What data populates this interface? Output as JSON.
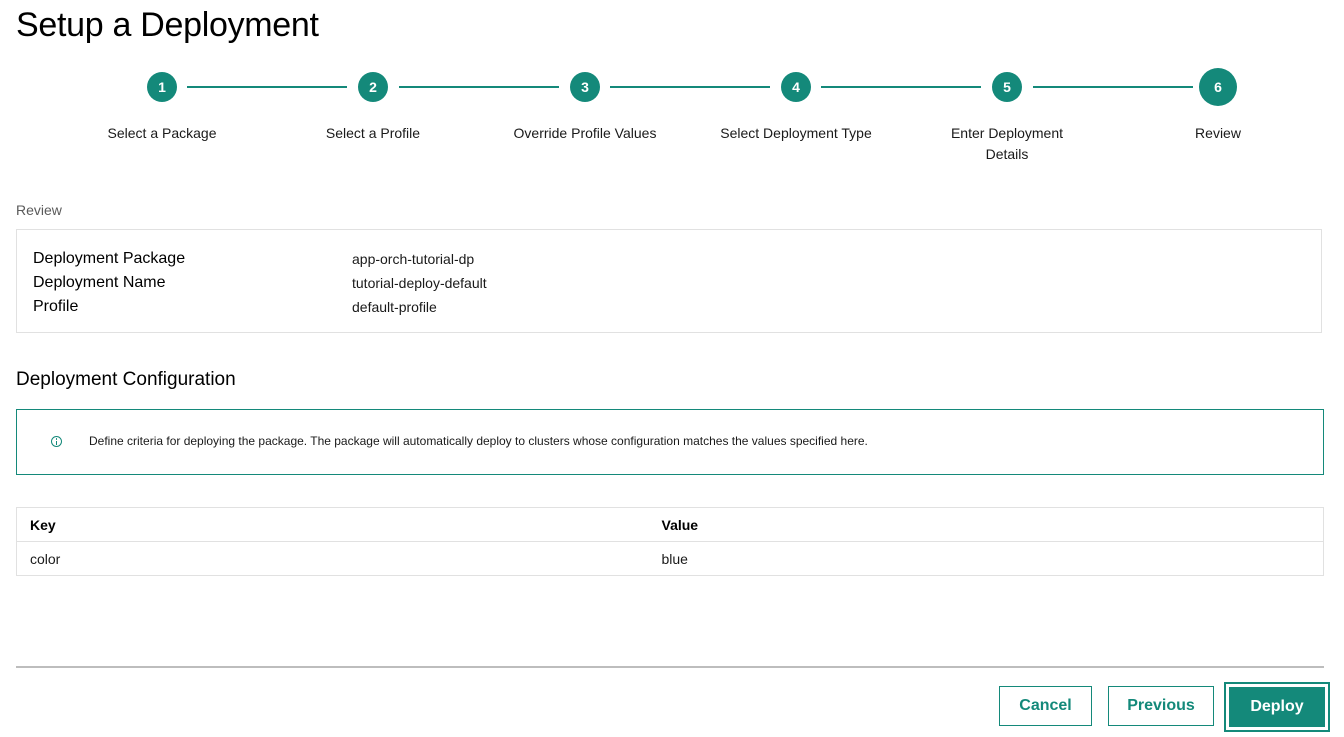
{
  "page_title": "Setup a Deployment",
  "stepper": {
    "steps": [
      {
        "number": "1",
        "label": "Select a Package"
      },
      {
        "number": "2",
        "label": "Select a Profile"
      },
      {
        "number": "3",
        "label": "Override Profile Values"
      },
      {
        "number": "4",
        "label": "Select Deployment Type"
      },
      {
        "number": "5",
        "label": "Enter Deployment Details"
      },
      {
        "number": "6",
        "label": "Review"
      }
    ],
    "current_step": "6"
  },
  "review": {
    "section_label": "Review",
    "rows": [
      {
        "key": "Deployment Package",
        "value": "app-orch-tutorial-dp"
      },
      {
        "key": "Deployment Name",
        "value": "tutorial-deploy-default"
      },
      {
        "key": "Profile",
        "value": "default-profile"
      }
    ]
  },
  "configuration": {
    "title": "Deployment Configuration",
    "info_icon": "info-icon",
    "info_text": "Define criteria for deploying the package. The package will automatically deploy to clusters whose configuration matches the values specified here.",
    "table": {
      "headers": [
        "Key",
        "Value"
      ],
      "rows": [
        [
          "color",
          "blue"
        ]
      ]
    }
  },
  "footer": {
    "cancel_label": "Cancel",
    "previous_label": "Previous",
    "deploy_label": "Deploy"
  },
  "colors": {
    "accent": "#14897a"
  }
}
